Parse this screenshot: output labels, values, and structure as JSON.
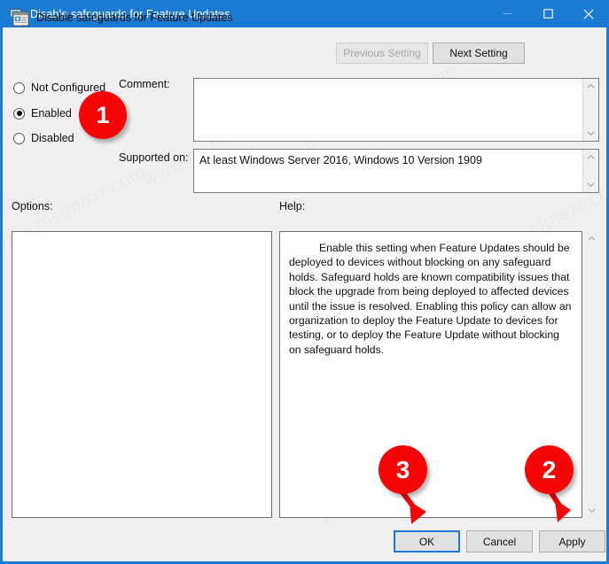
{
  "window": {
    "title": "Disable safeguards for Feature Updates",
    "title_icon": "computer-monitor-icon",
    "controls": {
      "minimize": "minimize-icon",
      "maximize": "maximize-icon",
      "close": "close-icon"
    },
    "accent_color": "#1b7ad1",
    "background_color": "#f0f0f0"
  },
  "header": {
    "policy_icon": "group-policy-setting-icon",
    "policy_title": "Disable safeguards for Feature Updates",
    "previous_setting_label": "Previous Setting",
    "previous_setting_enabled": false,
    "next_setting_label": "Next Setting",
    "next_setting_enabled": true
  },
  "state_options": [
    {
      "label": "Not Configured",
      "selected": false
    },
    {
      "label": "Enabled",
      "selected": true
    },
    {
      "label": "Disabled",
      "selected": false
    }
  ],
  "comment": {
    "label": "Comment:",
    "value": "",
    "placeholder": ""
  },
  "supported_on": {
    "label": "Supported on:",
    "value": "At least Windows Server 2016, Windows 10 Version 1909"
  },
  "options": {
    "label": "Options:",
    "value": ""
  },
  "help": {
    "label": "Help:",
    "text": "Enable this setting when Feature Updates should be deployed to devices without blocking on any safeguard holds. Safeguard holds are known compatibility issues that block the upgrade from being deployed to affected devices until the issue is resolved. Enabling this policy can allow an organization to deploy the Feature Update to devices for testing, or to deploy the Feature Update without blocking on safeguard holds."
  },
  "footer": {
    "ok_label": "OK",
    "cancel_label": "Cancel",
    "apply_label": "Apply",
    "focused_button": "OK"
  },
  "annotations": {
    "color": "#f50505",
    "markers": [
      {
        "number": "1",
        "points_to": "Enabled radio button"
      },
      {
        "number": "2",
        "points_to": "Apply button"
      },
      {
        "number": "3",
        "points_to": "OK button"
      }
    ]
  },
  "watermark": {
    "text": "www.msftnext.com",
    "color": "#e9e9e9"
  }
}
